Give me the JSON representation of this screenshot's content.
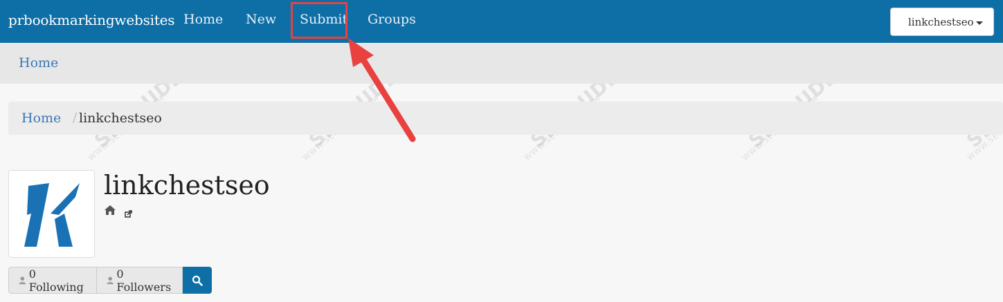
{
  "navbar": {
    "brand": "prbookmarkingwebsites",
    "links": [
      "Home",
      "New",
      "Submit",
      "Groups"
    ],
    "user_menu_label": "linkchestseo"
  },
  "subbar": {
    "home_label": "Home"
  },
  "breadcrumb": {
    "home": "Home",
    "separator": "/",
    "current": "linkchestseo"
  },
  "profile": {
    "username": "linkchestseo",
    "following_label": "0 Following",
    "followers_label": "0 Followers"
  },
  "watermark": {
    "brand": "SEOBUDDY",
    "domain": "WWW.SEOBUDDY.COM"
  },
  "colors": {
    "navbar": "#0e6ea6",
    "highlight": "#e8413f",
    "link": "#3a78b6",
    "logo": "#1a72b5"
  },
  "icons": [
    "caret-down-icon",
    "home-icon",
    "external-link-icon",
    "user-icon",
    "search-icon"
  ]
}
